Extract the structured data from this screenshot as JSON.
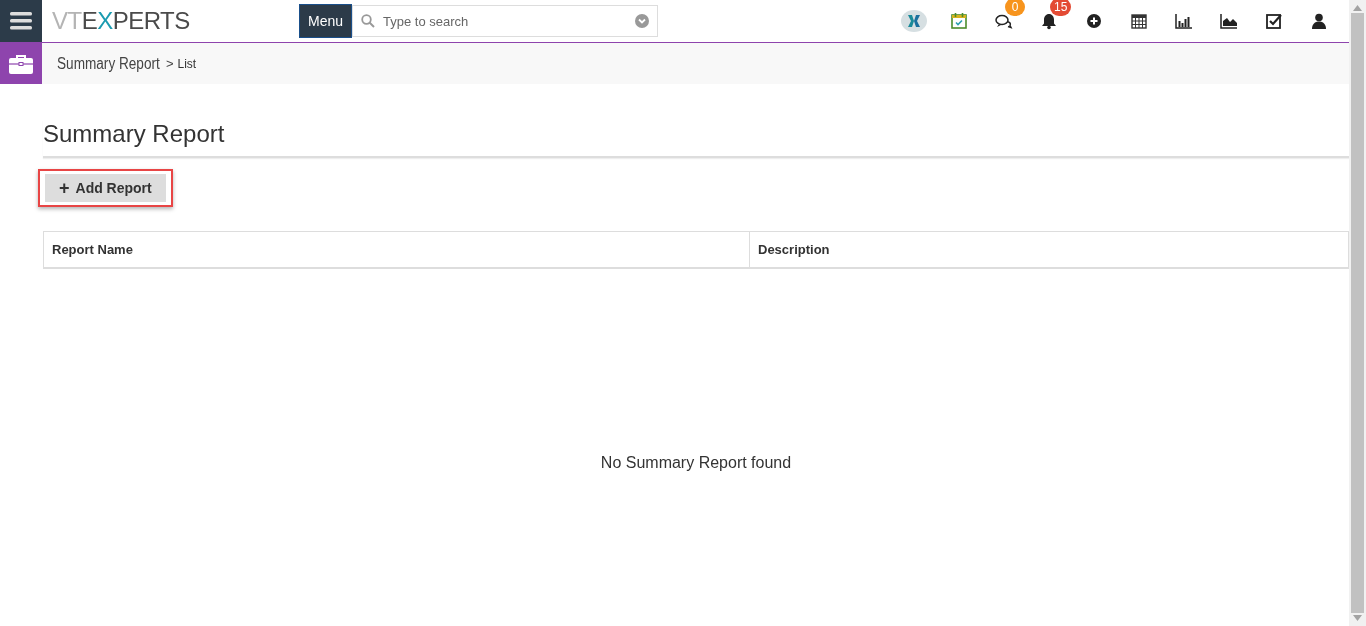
{
  "header": {
    "logo": [
      {
        "text": "VT",
        "color": "#b4b4b4"
      },
      {
        "text": "E",
        "color": "#4a4a4a"
      },
      {
        "text": "X",
        "color": "#1a9bb0"
      },
      {
        "text": "PERTS",
        "color": "#4a4a4a"
      }
    ],
    "menu_button": "Menu",
    "search": {
      "placeholder": "Type to search"
    },
    "icons": [
      {
        "kind": "brand"
      },
      {
        "kind": "calendar-check"
      },
      {
        "kind": "chat",
        "badge": "0",
        "color": "#f7941d"
      },
      {
        "kind": "bell",
        "badge": "15",
        "color": "#e34b34"
      },
      {
        "kind": "plus"
      },
      {
        "kind": "calendar"
      },
      {
        "kind": "bar-chart"
      },
      {
        "kind": "area-chart"
      },
      {
        "kind": "checkbox"
      },
      {
        "kind": "user"
      }
    ]
  },
  "breadcrumb": {
    "module": "Summary Report",
    "separator": ">",
    "page": "List"
  },
  "page_title": "Summary Report",
  "add_button": {
    "icon": "+",
    "label": "Add Report",
    "highlighted": true
  },
  "table": {
    "columns": [
      "Report Name",
      "Description"
    ]
  },
  "empty_message": "No Summary Report found"
}
